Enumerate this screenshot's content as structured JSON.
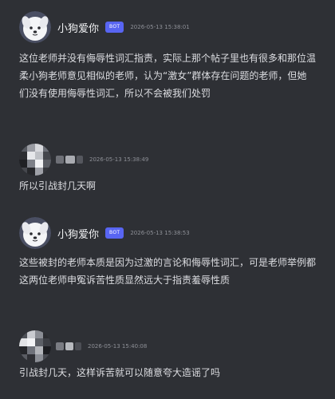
{
  "messages": [
    {
      "author": "小狗爱你",
      "badge": "BOT",
      "timestamp": "2026-05-13  15:38:01",
      "text": "这位老师并没有侮辱性词汇指责，实际上那个帖子里也有很多和那位温柔小狗老师意见相似的老师，认为“激女”群体存在问题的老师，但她们没有使用侮辱性词汇，所以不会被我们处罚",
      "avatar_icon": "dog-mascot-icon"
    },
    {
      "author": "",
      "timestamp": "2026-05-13  15:38:49",
      "text": "所以引战封几天啊",
      "avatar_icon": "pixelated-avatar-icon"
    },
    {
      "author": "小狗爱你",
      "badge": "BOT",
      "timestamp": "2026-05-13  15:38:53",
      "text": "这些被封的老师本质是因为过激的言论和侮辱性词汇，可是老师举例都这两位老师申冤诉苦性质显然远大于指责羞辱性质",
      "avatar_icon": "dog-mascot-icon"
    },
    {
      "author": "",
      "timestamp": "2026-05-13  15:40:08",
      "text": "引战封几天，这样诉苦就可以随意夸大造谣了吗",
      "avatar_icon": "pixelated-avatar-icon"
    }
  ],
  "colors": {
    "background": "#2e3035",
    "badge": "#5865f2",
    "text": "#dcdde1",
    "timestamp": "#8e9097"
  }
}
